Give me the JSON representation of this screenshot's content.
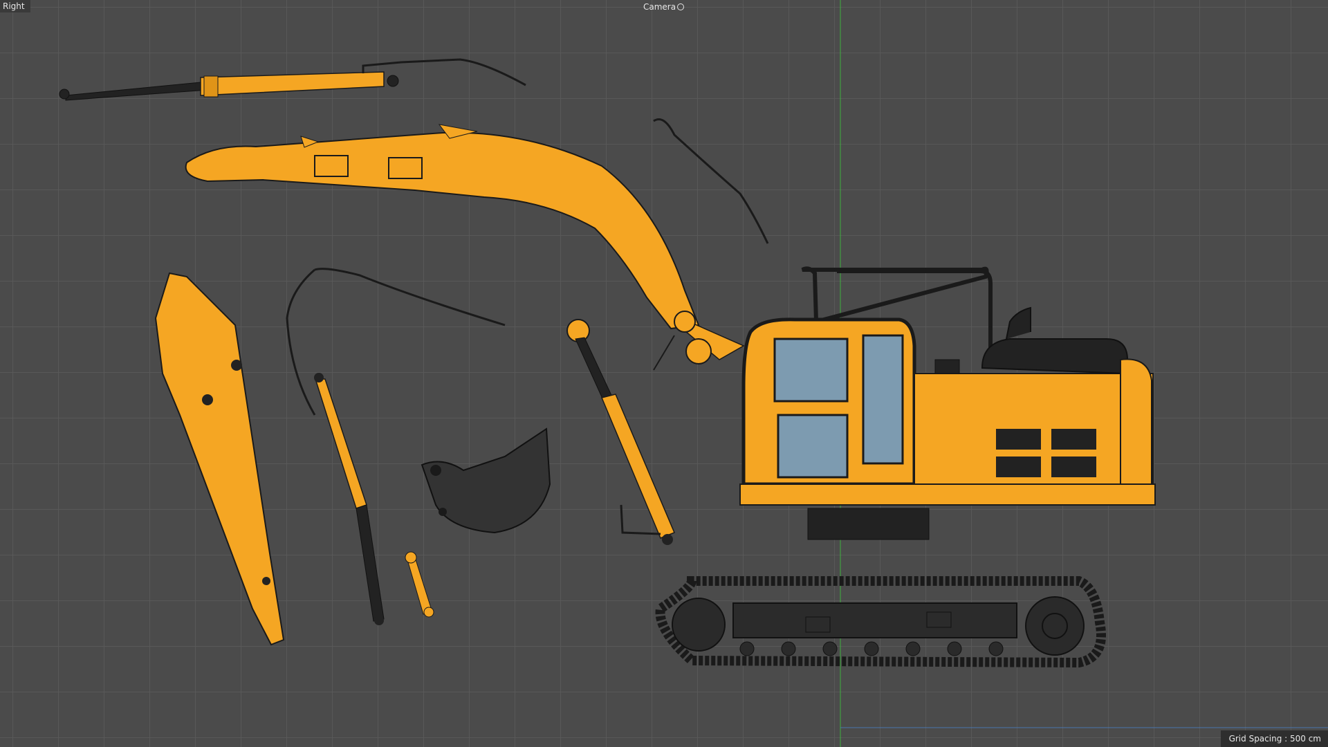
{
  "viewport": {
    "view_name": "Right",
    "camera_label": "Camera",
    "grid_spacing_text": "Grid Spacing : 500 cm"
  },
  "colors": {
    "background": "#4b4b4b",
    "grid_line": "#5a5a5a",
    "model_orange": "#f5a623",
    "wire_black": "#1a1a1a",
    "axis_green": "#3cc83c",
    "axis_blue": "#4a7ab8"
  },
  "icons": {
    "camera": "camera-orbit-icon"
  }
}
